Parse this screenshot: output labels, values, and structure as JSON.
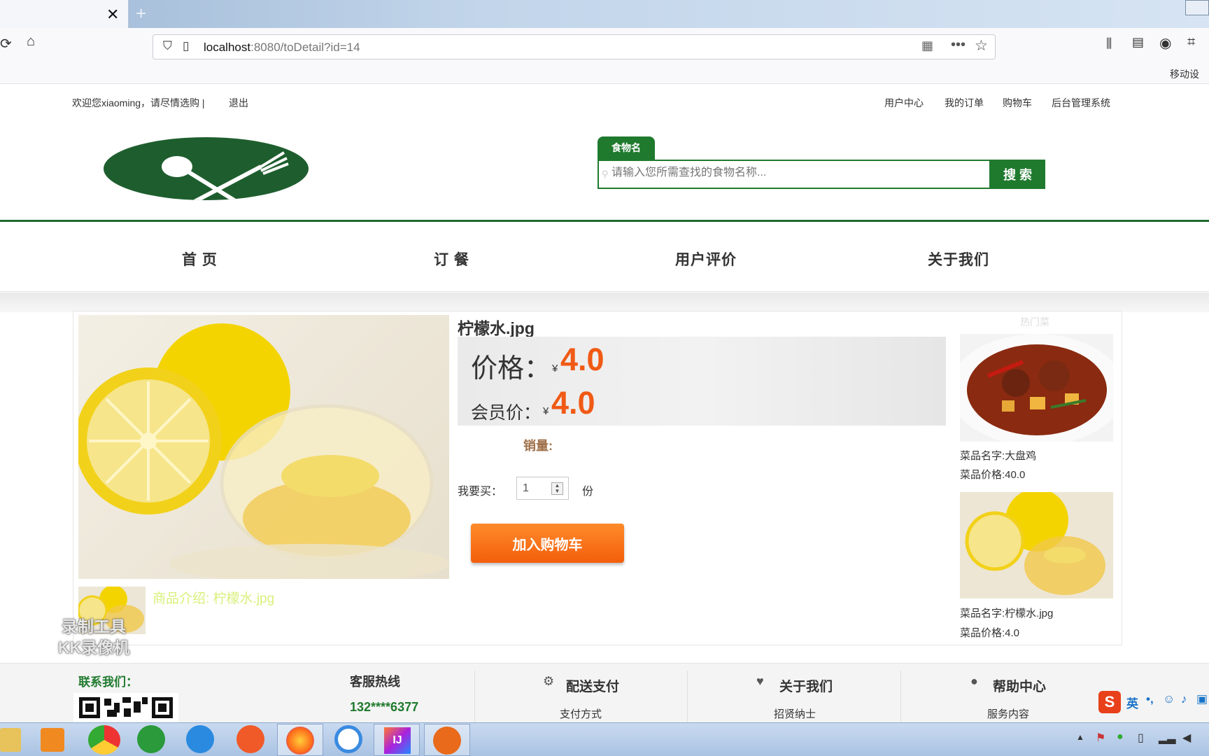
{
  "browser": {
    "tab_close": "✕",
    "new_tab": "+",
    "url_host": "localhost",
    "url_rest": ":8080/toDetail?id=14",
    "bookmark_item": "移动设"
  },
  "topbar": {
    "welcome": "欢迎您xiaoming，请尽情选购 |",
    "logout": "退出",
    "links": [
      "用户中心",
      "我的订单",
      "购物车",
      "后台管理系统"
    ]
  },
  "search": {
    "tab_label": "食物名",
    "placeholder": "请输入您所需查找的食物名称...",
    "button": "搜 索"
  },
  "nav": [
    "首 页",
    "订 餐",
    "用户评价",
    "关于我们"
  ],
  "product": {
    "name": "柠檬水.jpg",
    "price_label": "价格：",
    "price_currency": "¥",
    "price": "4.0",
    "member_label": "会员价：",
    "member_price": "4.0",
    "sales_label": "销量:",
    "buy_label": "我要买：",
    "quantity": "1",
    "unit": "份",
    "cart_button": "加入购物车",
    "intro": "商品介绍:  柠檬水.jpg"
  },
  "hot": {
    "title": "热门菜",
    "items": [
      {
        "name": "菜品名字:大盘鸡",
        "price": "菜品价格:40.0"
      },
      {
        "name": "菜品名字:柠檬水.jpg",
        "price": "菜品价格:4.0"
      }
    ]
  },
  "footer": {
    "contact": "联系我们：",
    "hotline_label": "客服热线",
    "hotline": "132****6377",
    "cols": [
      {
        "title": "配送支付",
        "sub": "支付方式"
      },
      {
        "title": "关于我们",
        "sub": "招贤纳士"
      },
      {
        "title": "帮助中心",
        "sub": "服务内容"
      }
    ]
  },
  "watermark": {
    "line1": "录制工具",
    "line2": "KK录像机"
  },
  "ime": {
    "lang": "英"
  }
}
